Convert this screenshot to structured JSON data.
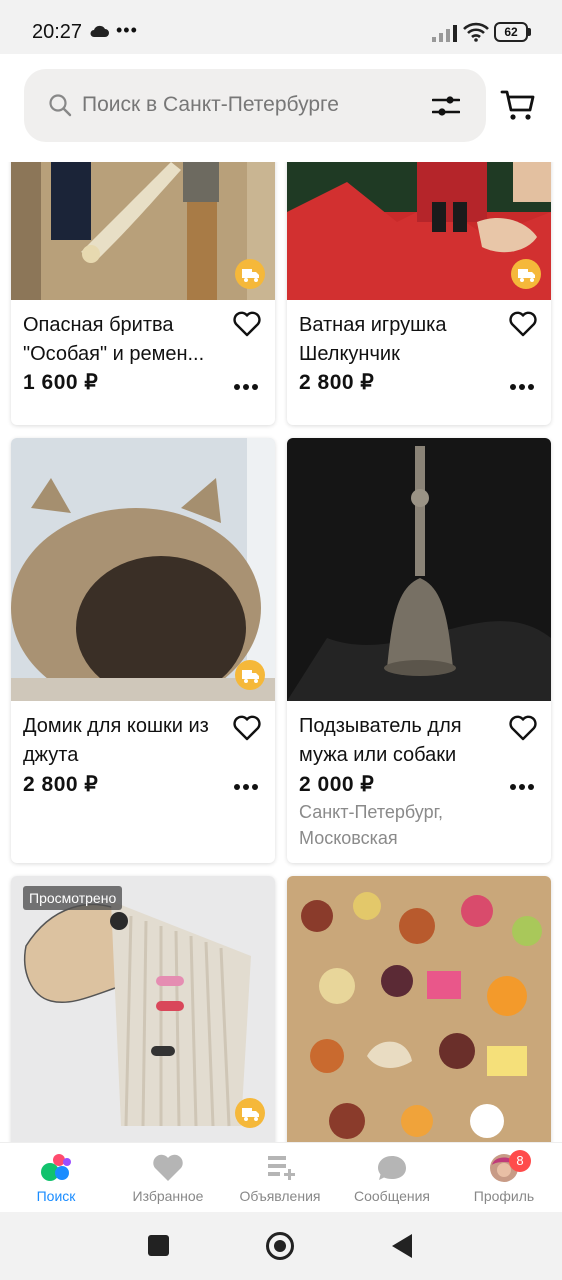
{
  "status_bar": {
    "time": "20:27",
    "extra": "•••",
    "battery": "62"
  },
  "header": {
    "search_placeholder": "Поиск в Санкт-Петербурге",
    "icons": [
      "search-icon",
      "filter-icon",
      "cart-icon"
    ]
  },
  "listings": [
    {
      "title": "Опасная бритва \"Особая\" и ремен...",
      "price": "1 600 ₽",
      "delivery": true
    },
    {
      "title": "Ватная игрушка Шелкунчик",
      "price": "2 800 ₽",
      "delivery": true
    },
    {
      "title": "Домик для кошки из джута",
      "price": "2 800 ₽",
      "delivery": true
    },
    {
      "title": "Подзыватель для мужа или собаки",
      "price": "2 000 ₽",
      "location": "Санкт-Петербург, Московская",
      "delivery": false
    },
    {
      "badge": "Просмотрено",
      "delivery": true
    },
    {
      "delivery": false
    }
  ],
  "bottom_nav": [
    {
      "label": "Поиск",
      "active": true,
      "icon": "search-dots-icon"
    },
    {
      "label": "Избранное",
      "icon": "heart-icon"
    },
    {
      "label": "Объявления",
      "icon": "ads-add-icon"
    },
    {
      "label": "Сообщения",
      "icon": "chat-icon"
    },
    {
      "label": "Профиль",
      "icon": "avatar",
      "badge": "8"
    }
  ],
  "colors": {
    "accent": "#1a8cff",
    "delivery_badge": "#f5b83a",
    "notification_badge": "#ff4b4b"
  }
}
